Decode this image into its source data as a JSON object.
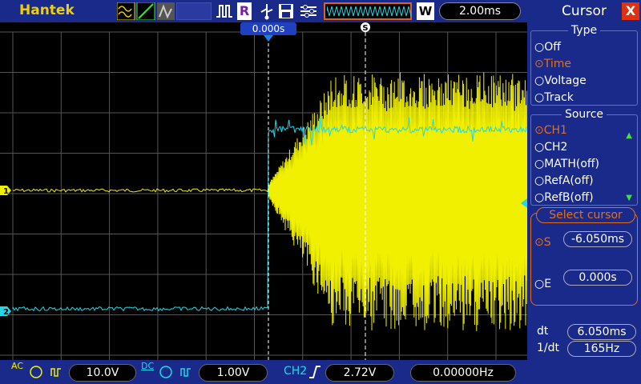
{
  "header": {
    "brand": "Hantek",
    "acq_mode": "R",
    "w_button": "W",
    "timebase": "2.00ms"
  },
  "scope": {
    "trigger_time_label": "0.000s",
    "cursor_marker": "S",
    "ch1_marker": "1",
    "ch2_marker": "2",
    "ch1_color": "#f0f000",
    "ch2_color": "#20d8e8"
  },
  "footer": {
    "ch1_coupling": "AC",
    "ch1_scale": "10.0V",
    "ch2_coupling": "DC",
    "ch2_scale": "1.00V",
    "trigger_source": "CH2",
    "trigger_level": "2.72V",
    "frequency": "0.00000Hz"
  },
  "panel": {
    "title": "Cursor",
    "close_label": "X",
    "type_title": "Type",
    "type_options": [
      "Off",
      "Time",
      "Voltage",
      "Track"
    ],
    "type_selected": "Time",
    "source_title": "Source",
    "source_options": [
      "CH1",
      "CH2",
      "MATH(off)",
      "RefA(off)",
      "RefB(off)"
    ],
    "source_selected": "CH1",
    "select_title": "Select cursor",
    "s_label": "S",
    "s_value": "-6.050ms",
    "e_label": "E",
    "e_value": "0.000s",
    "dt_label": "dt",
    "dt_value": "6.050ms",
    "inv_dt_label": "1/dt",
    "inv_dt_value": "165Hz"
  }
}
